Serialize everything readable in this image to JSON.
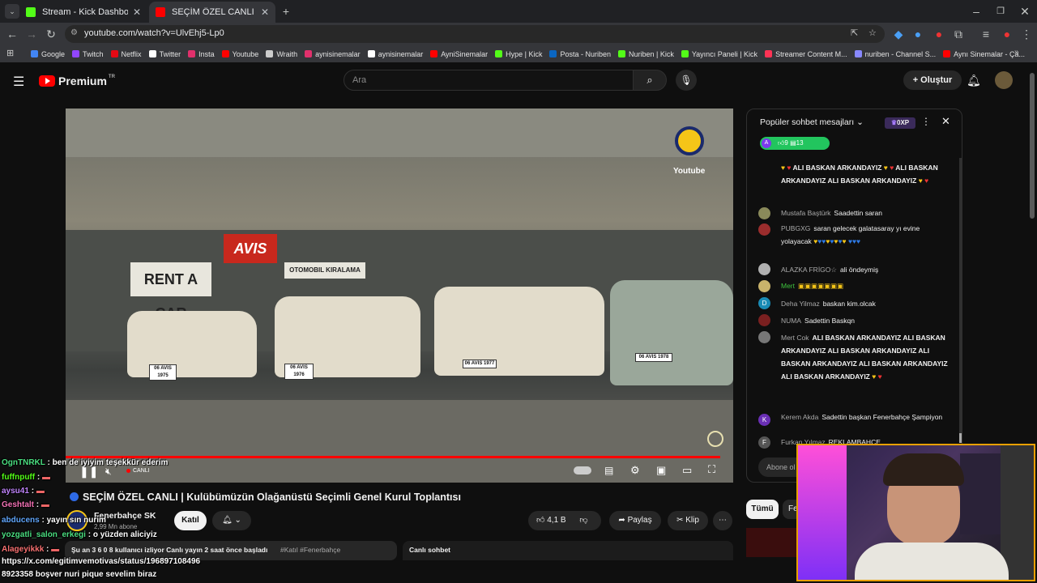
{
  "browser": {
    "tabs": [
      {
        "title": "Stream - Kick Dashboard",
        "favicon_color": "#53fc18"
      },
      {
        "title": "SEÇİM ÖZEL CANLI | Kulübü",
        "favicon_color": "#ff0000"
      }
    ],
    "url": "youtube.com/watch?v=UlvEhj5-Lp0",
    "bookmarks": [
      {
        "label": "Google",
        "color": "#4285f4"
      },
      {
        "label": "Twitch",
        "color": "#9146ff"
      },
      {
        "label": "Netflix",
        "color": "#e50914"
      },
      {
        "label": "Twitter",
        "color": "#ffffff"
      },
      {
        "label": "Insta",
        "color": "#e1306c"
      },
      {
        "label": "Youtube",
        "color": "#ff0000"
      },
      {
        "label": "Wraith",
        "color": "#cccccc"
      },
      {
        "label": "aynisinemalar",
        "color": "#e1306c"
      },
      {
        "label": "aynisinemalar",
        "color": "#ffffff"
      },
      {
        "label": "AyniSinemalar",
        "color": "#ff0000"
      },
      {
        "label": "Hype | Kick",
        "color": "#53fc18"
      },
      {
        "label": "Posta - Nuriben",
        "color": "#0a66c2"
      },
      {
        "label": "Nuriben | Kick",
        "color": "#53fc18"
      },
      {
        "label": "Yayıncı Paneli | Kick",
        "color": "#53fc18"
      },
      {
        "label": "Streamer Content M...",
        "color": "#ff3355"
      },
      {
        "label": "nuriben - Channel S...",
        "color": "#8888ff"
      },
      {
        "label": "Aynı Sinemalar - Ça...",
        "color": "#ff0000"
      }
    ]
  },
  "youtube": {
    "logo_text": "Premium",
    "logo_region": "TR",
    "search_placeholder": "Ara",
    "create_label": "Oluştur"
  },
  "video": {
    "live_label": "CANLI",
    "watermark": "Youtube",
    "sign": "RENT A CAR",
    "brand": "AVIS",
    "sign2": "OTOMOBIL KIRALAMA",
    "plates": [
      "06 AVIS 1975",
      "06 AVIS 1976",
      "06 AVIS 1977",
      "06 AVIS 1978"
    ],
    "title": "SEÇİM ÖZEL CANLI | Kulübümüzün Olağanüstü Seçimli Genel Kurul Toplantısı",
    "channel": "Fenerbahçe SK",
    "subscribers": "2,99 Mn abone",
    "join_label": "Katıl",
    "likes": "4,1 B",
    "share_label": "Paylaş",
    "clip_label": "Klip",
    "watching": "Şu an 3 6 0 8 kullanıcı izliyor  Canlı yayın 2 saat önce başladı",
    "tags": "#Katıl #Fenerbahçe",
    "live_chat_label": "Canlı sohbet",
    "progress": 0.99
  },
  "chat": {
    "header": "Popüler sohbet mesajları",
    "xp": "0XP",
    "likes": "9",
    "replies": "13",
    "subscribe_hint": "Abone ol",
    "filter_all": "Tümü",
    "filter_fe": "Fe",
    "messages": [
      {
        "author": "",
        "text": "ALI BASKAN ARKANDAYIZ",
        "avatar": "#6b6b6b"
      },
      {
        "author": "",
        "text": "BASKAN ARKANDAYIZ  ALI BASKAN",
        "avatar": ""
      },
      {
        "author": "",
        "text": "ARKANDAYIZ",
        "avatar": ""
      },
      {
        "author": "Mustafa Baştürk",
        "text": "Saadettin saran",
        "avatar": "#8a8a5a"
      },
      {
        "author": "PUBGXG",
        "text": "saran gelecek galatasaray yı evine yolayacak",
        "avatar": "#9b2d2d"
      },
      {
        "author": "ALAZKA FRİGO☆",
        "text": "ali öndeymiş",
        "avatar": "#b0b0b0"
      },
      {
        "author": "Mert",
        "text": "",
        "avatar": "#c9b36b"
      },
      {
        "author": "Deha Yilmaz",
        "text": "baskan kim.olcak",
        "avatar": "#1a8bb5"
      },
      {
        "author": "NUMA",
        "text": "Sadettin Baskqn",
        "avatar": "#7a2020"
      },
      {
        "author": "Mert Cok",
        "text": "ALI BASKAN ARKANDAYIZ  ALI BASKAN ARKANDAYIZ  ALI BASKAN ARKANDAYIZ  ALI BASKAN ARKANDAYIZ  ALI BASKAN ARKANDAYIZ  ALI BASKAN ARKANDAYIZ",
        "avatar": "#777"
      },
      {
        "author": "Kerem Akda",
        "text": "Sadettin başkan Fenerbahçe Şampiyon",
        "avatar": "#6a2fb5"
      },
      {
        "author": "Furkan Yılmaz",
        "text": "REKLAMBAHCE",
        "avatar": "#555"
      }
    ]
  },
  "overlay_chat": [
    {
      "user": "OgnTNRKL",
      "color": "#4ade80",
      "text": "ben de iyiyim teşekkür ederim"
    },
    {
      "user": "fuffnpuff",
      "color": "#53fc18",
      "text": ""
    },
    {
      "user": "aysu41",
      "color": "#c084fc",
      "text": ""
    },
    {
      "user": "Geshtalt",
      "color": "#f472b6",
      "text": ""
    },
    {
      "user": "abducens",
      "color": "#60a5fa",
      "text": "yayın  sın nurim"
    },
    {
      "user": "yozgatli_salon_erkegi",
      "color": "#4ade80",
      "text": "o yüzden aliciyiz"
    },
    {
      "user": "Alageyikkk",
      "color": "#f87171",
      "text": ""
    },
    {
      "user": "",
      "color": "#ffffff",
      "text": "https://x.com/egitimvemotivas/status/196897108496"
    },
    {
      "user": "",
      "color": "#ffffff",
      "text": "8923358 boşver nuri pique sevelim biraz"
    }
  ]
}
